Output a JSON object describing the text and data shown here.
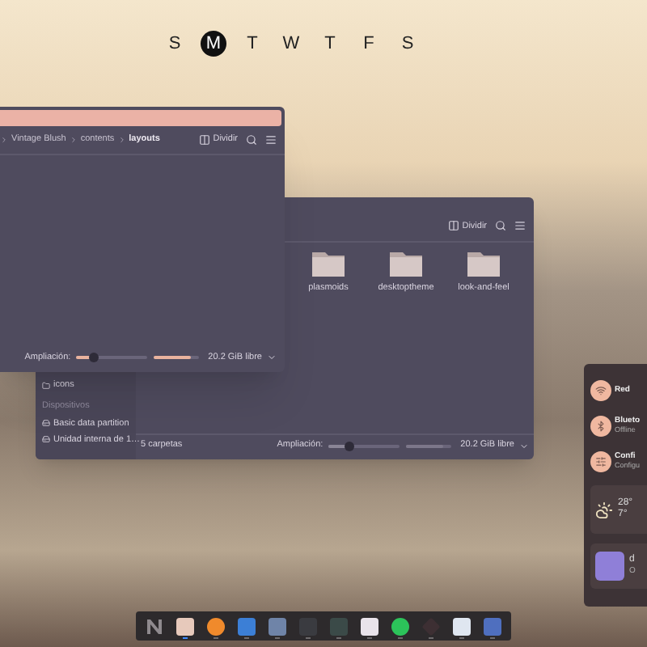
{
  "weekdays": [
    {
      "label": "S",
      "selected": false
    },
    {
      "label": "M",
      "selected": true
    },
    {
      "label": "T",
      "selected": false
    },
    {
      "label": "W",
      "selected": false
    },
    {
      "label": "T",
      "selected": false
    },
    {
      "label": "F",
      "selected": false
    },
    {
      "label": "S",
      "selected": false
    }
  ],
  "back_window": {
    "active": false,
    "split_button": "Dividir",
    "folders": [
      {
        "label": "plasmoids"
      },
      {
        "label": "desktoptheme"
      },
      {
        "label": "look-and-feel"
      }
    ],
    "sidebar": {
      "items": [
        {
          "label": "icons",
          "selected": false
        }
      ],
      "sections": [
        {
          "title": "Dispositivos",
          "items": [
            {
              "label": "Basic data partition",
              "selected": false
            },
            {
              "label": "Unidad interna de 1…",
              "selected": false
            }
          ]
        }
      ]
    },
    "status": {
      "count": "5 carpetas",
      "zoom_label": "Ampliación:",
      "zoom_slider": {
        "level": 0.3
      },
      "capacity_bar": {
        "level": 0.85
      },
      "free_space": "20.2 GiB libre"
    }
  },
  "front_window": {
    "active": true,
    "split_button": "Dividir",
    "breadcrumb": [
      {
        "label": "Vintage Blush",
        "current": false
      },
      {
        "label": "contents",
        "current": false
      },
      {
        "label": "layouts",
        "current": true
      }
    ],
    "status": {
      "zoom_label": "Ampliación:",
      "zoom_slider": {
        "level": 0.25
      },
      "capacity_bar": {
        "level": 0.85
      },
      "free_space": "20.2 GiB libre"
    }
  },
  "panel": {
    "toggles": [
      {
        "kind": "network",
        "title": "Red"
      },
      {
        "kind": "bluetooth",
        "title": "Blueto",
        "subtitle": "Offline"
      },
      {
        "kind": "settings",
        "title": "Confi",
        "subtitle": "Configu"
      }
    ],
    "weather": {
      "high": "28°",
      "low": "7°"
    },
    "user": {
      "name": "d",
      "status": "O"
    }
  },
  "dock": [
    {
      "kind": "logo",
      "running": false,
      "focused": false
    },
    {
      "kind": "files",
      "running": true,
      "focused": true
    },
    {
      "kind": "browser",
      "running": true,
      "focused": false
    },
    {
      "kind": "store",
      "running": true,
      "focused": false
    },
    {
      "kind": "images",
      "running": true,
      "focused": false
    },
    {
      "kind": "terminal",
      "running": true,
      "focused": false
    },
    {
      "kind": "calculator",
      "running": true,
      "focused": false
    },
    {
      "kind": "document",
      "running": true,
      "focused": false
    },
    {
      "kind": "music",
      "running": true,
      "focused": false
    },
    {
      "kind": "mountain",
      "running": true,
      "focused": false
    },
    {
      "kind": "notes",
      "running": true,
      "focused": false
    },
    {
      "kind": "settings",
      "running": true,
      "focused": false
    }
  ]
}
